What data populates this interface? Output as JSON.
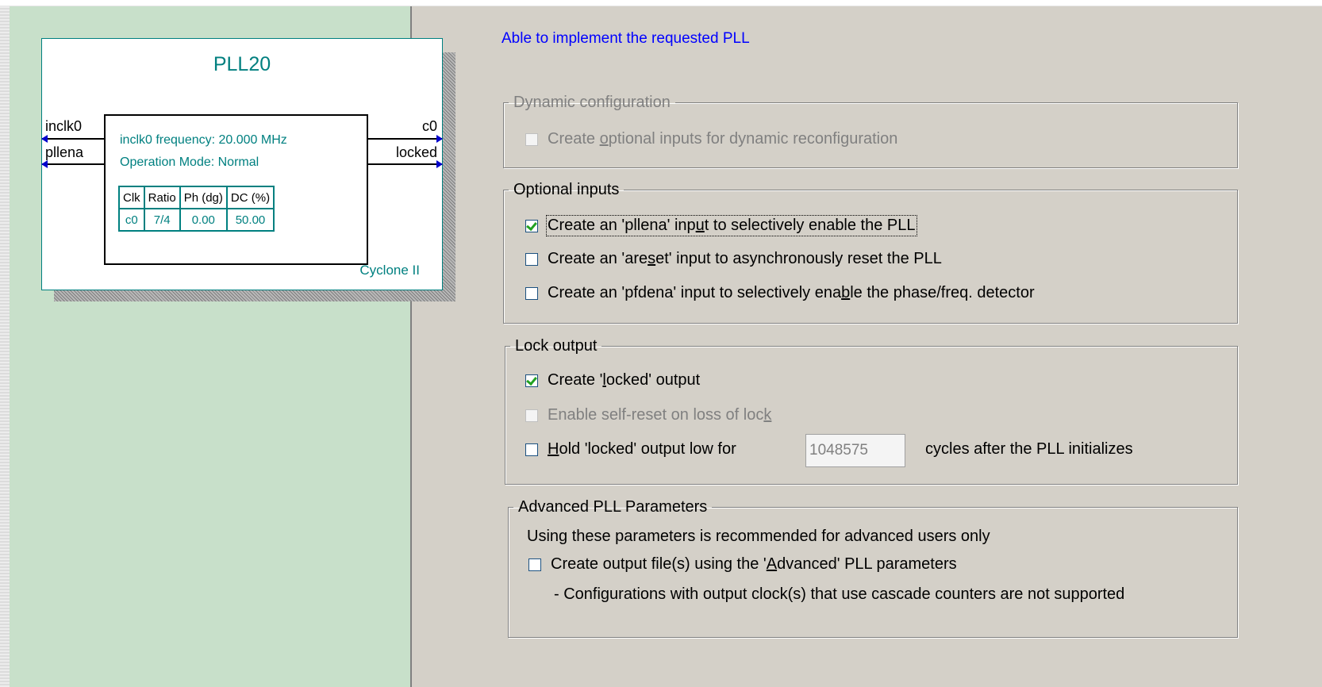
{
  "status_message": "Able to implement the requested PLL",
  "symbol": {
    "title": "PLL20",
    "input_pins": [
      "inclk0",
      "pllena"
    ],
    "output_pins": [
      "c0",
      "locked"
    ],
    "frequency_line": "inclk0 frequency: 20.000 MHz",
    "mode_line": "Operation Mode: Normal",
    "table_headers": [
      "Clk",
      "Ratio",
      "Ph (dg)",
      "DC (%)"
    ],
    "table_rows": [
      [
        "c0",
        "7/4",
        "0.00",
        "50.00"
      ]
    ],
    "device": "Cyclone II"
  },
  "dynamic_config": {
    "title": "Dynamic configuration",
    "option_prefix": "Create ",
    "option_ul": "o",
    "option_rest": "ptional inputs for dynamic reconfiguration",
    "option_checked": false
  },
  "optional_inputs": {
    "title": "Optional inputs",
    "pllena": {
      "prefix": "Create an 'pllena' inp",
      "ul": "u",
      "rest": "t to selectively enable the PLL",
      "checked": true
    },
    "areset": {
      "prefix": "Create an 'are",
      "ul": "s",
      "rest": "et' input to asynchronously reset the PLL",
      "checked": false
    },
    "pfdena": {
      "prefix": "Create an 'pfdena' input to selectively ena",
      "ul": "b",
      "rest": "le the phase/freq. detector",
      "checked": false
    }
  },
  "lock_output": {
    "title": "Lock output",
    "create_locked": {
      "prefix": "Create '",
      "ul": "l",
      "rest": "ocked' output",
      "checked": true
    },
    "self_reset": {
      "prefix": "Enable self-reset on loss of loc",
      "ul": "k",
      "rest": "",
      "checked": false
    },
    "hold_low": {
      "prefix": "",
      "ul": "H",
      "rest": "old 'locked' output low for",
      "checked": false
    },
    "hold_cycles_value": "1048575",
    "hold_suffix": "cycles after the PLL initializes"
  },
  "advanced": {
    "title": "Advanced PLL Parameters",
    "note": "Using these parameters is recommended for advanced users only",
    "option_prefix": "Create output file(s) using the '",
    "option_ul": "A",
    "option_rest": "dvanced' PLL parameters",
    "option_checked": false,
    "footnote": "- Configurations with output clock(s) that use cascade counters are not supported"
  }
}
